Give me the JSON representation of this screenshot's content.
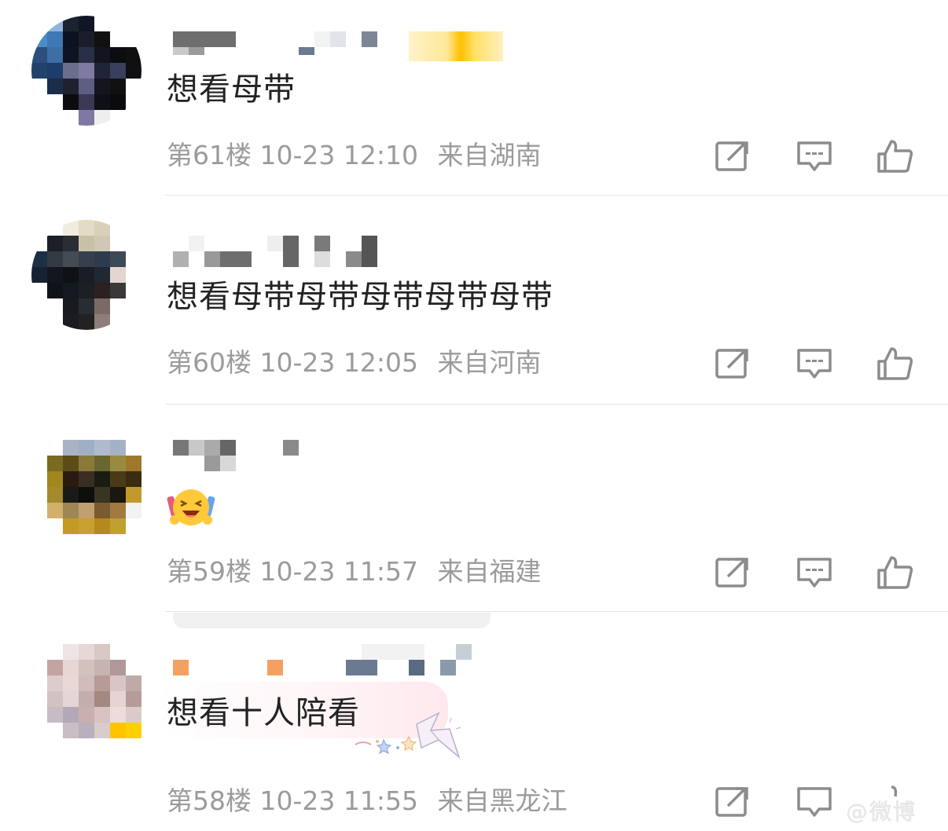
{
  "comments": [
    {
      "text": "想看母带",
      "floor": "第61楼",
      "time": "10-23 12:10",
      "location": "来自湖南"
    },
    {
      "text": "想看母带母带母带母带母带",
      "floor": "第60楼",
      "time": "10-23 12:05",
      "location": "来自河南"
    },
    {
      "text": "",
      "emoji": "laughing-emoji",
      "floor": "第59楼",
      "time": "10-23 11:57",
      "location": "来自福建"
    },
    {
      "text": "想看十人陪看",
      "floor": "第58楼",
      "time": "10-23 11:55",
      "location": "来自黑龙江"
    }
  ],
  "actions": {
    "share_icon": "share-icon",
    "reply_icon": "comment-icon",
    "like_icon": "thumbs-up-icon"
  },
  "colors": {
    "text": "#222222",
    "meta": "#9b9b9b",
    "divider": "#e6e6e6",
    "icon": "#8c8c8c"
  },
  "watermark": "@微博"
}
